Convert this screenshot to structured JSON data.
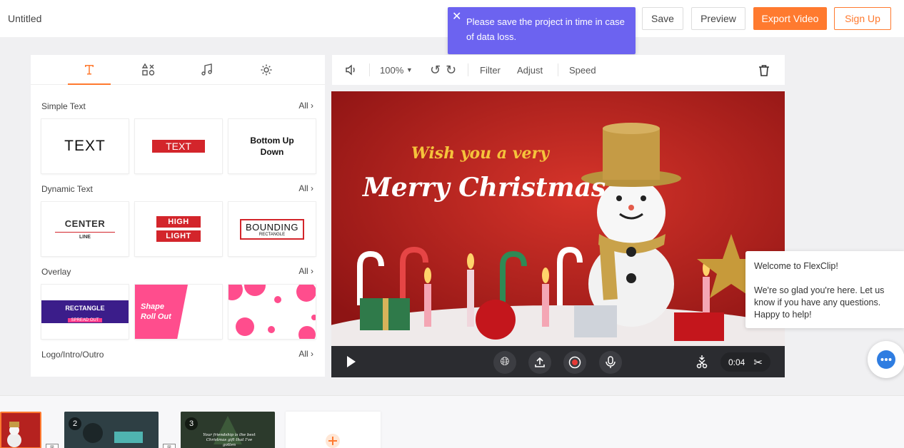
{
  "header": {
    "title": "Untitled",
    "save": "Save",
    "preview": "Preview",
    "export": "Export Video",
    "signup": "Sign Up"
  },
  "toast": {
    "message": "Please save the project in time in case of data loss."
  },
  "tabs": [
    "text-icon",
    "elements-icon",
    "music-icon",
    "settings-icon"
  ],
  "sections": [
    {
      "title": "Simple Text",
      "all": "All"
    },
    {
      "title": "Dynamic Text",
      "all": "All"
    },
    {
      "title": "Overlay",
      "all": "All"
    },
    {
      "title": "Logo/Intro/Outro",
      "all": "All"
    }
  ],
  "cards": {
    "simple1": "TEXT",
    "simple2": "TEXT",
    "simple3a": "Bottom Up",
    "simple3b": "Down",
    "dyn1a": "CENTER",
    "dyn1b": "LINE",
    "dyn2a": "HIGH",
    "dyn2b": "LIGHT",
    "dyn3a": "BOUNDING",
    "dyn3b": "RECTANGLE",
    "ov1a": "RECTANGLE",
    "ov1b": "SPREAD OUT",
    "ov2a": "Shape",
    "ov2b": "Roll Out"
  },
  "toolbar": {
    "zoom": "100%",
    "filter": "Filter",
    "adjust": "Adjust",
    "speed": "Speed"
  },
  "video": {
    "line1": "Wish you a very",
    "line2": "Merry Christmas"
  },
  "controls": {
    "time": "0:04"
  },
  "chat": {
    "line1": "Welcome to FlexClip!",
    "line2": "We're so glad you're here. Let us know if you have any questions. Happy to help!"
  },
  "timeline": {
    "clips": [
      "2",
      "3"
    ],
    "clip3_text": "Your friendship is the best Christmas gift that I've gotten"
  },
  "colors": {
    "accent": "#ff7a2f",
    "toast": "#6c63f0",
    "red": "#d3252b"
  }
}
